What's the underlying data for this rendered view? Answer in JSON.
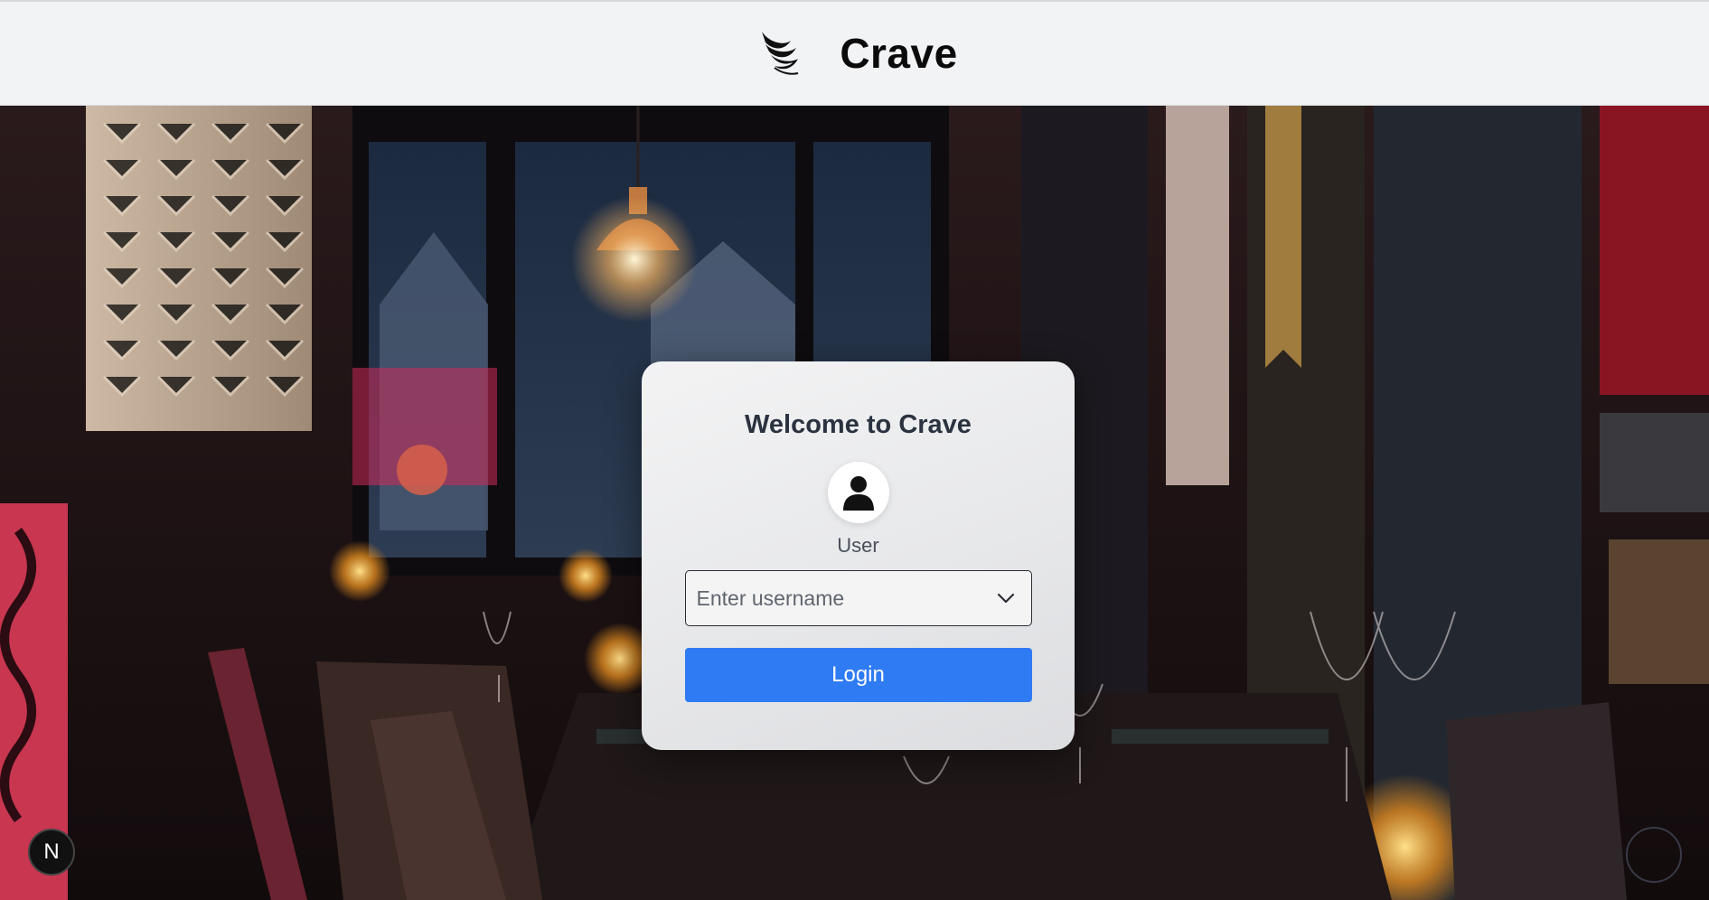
{
  "header": {
    "brand_name": "Crave",
    "logo_icon": "bird-wing-icon"
  },
  "login": {
    "title": "Welcome to Crave",
    "avatar_icon": "user-icon",
    "role_label": "User",
    "username_select": {
      "placeholder": "Enter username",
      "icon": "chevron-down-icon"
    },
    "login_label": "Login"
  },
  "dev_badge": {
    "label": "N"
  },
  "colors": {
    "header_bg": "#f2f3f5",
    "primary": "#2f7bf3",
    "title_text": "#2b3240"
  }
}
